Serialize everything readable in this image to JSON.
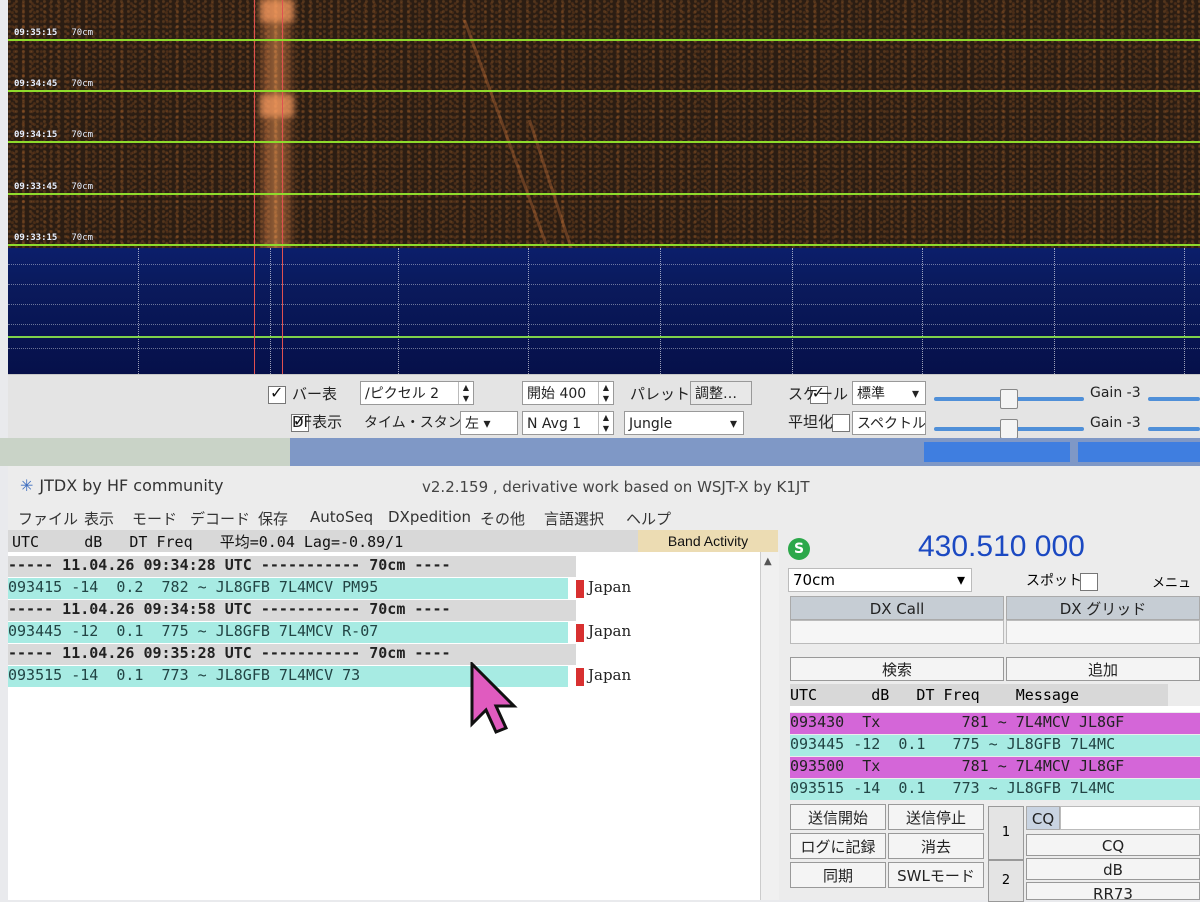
{
  "waterfall": {
    "rows": [
      {
        "time": "09:35:15",
        "band": "70cm"
      },
      {
        "time": "09:34:45",
        "band": "70cm"
      },
      {
        "time": "09:34:15",
        "band": "70cm"
      },
      {
        "time": "09:33:45",
        "band": "70cm"
      },
      {
        "time": "09:33:15",
        "band": "70cm"
      }
    ]
  },
  "controls": {
    "bar_label": "バー表",
    "df_label": "DF表示",
    "bins_label": "/ピクセル",
    "bins_value": "2",
    "timestamp_label": "タイム・スタンプ",
    "timestamp_value": "左",
    "start_label": "開始 400",
    "navg_label": "N Avg 1",
    "palette_label": "パレット",
    "adjust_button": "調整…",
    "palette_value": "Jungle",
    "scale_label": "スケール",
    "scale_value": "標準",
    "flatten_label": "平坦化",
    "spectrum_value": "スペクトル",
    "gain1_label": "Gain -3",
    "gain2_label": "Gain -3"
  },
  "window": {
    "title": "JTDX   by HF community",
    "version": "v2.2.159 , derivative work based on WSJT-X by K1JT"
  },
  "menu": [
    "ファイル",
    "表示",
    "モード",
    "デコード",
    "保存",
    "AutoSeq",
    "DXpedition",
    "その他",
    "言語選択",
    "ヘルプ"
  ],
  "band_activity": {
    "header": "UTC     dB   DT Freq   平均=0.04 Lag=-0.89/1",
    "label": "Band Activity",
    "rows": [
      {
        "kind": "sep",
        "text": "----- 11.04.26 09:34:28 UTC ----------- 70cm ----"
      },
      {
        "kind": "dec",
        "text": "093415 -14  0.2  782 ~ JL8GFB 7L4MCV PM95",
        "country": "Japan"
      },
      {
        "kind": "sep",
        "text": "----- 11.04.26 09:34:58 UTC ----------- 70cm ----"
      },
      {
        "kind": "dec",
        "text": "093445 -12  0.1  775 ~ JL8GFB 7L4MCV R-07",
        "country": "Japan"
      },
      {
        "kind": "sep",
        "text": "----- 11.04.26 09:35:28 UTC ----------- 70cm ----"
      },
      {
        "kind": "dec",
        "text": "093515 -14  0.1  773 ~ JL8GFB 7L4MCV 73",
        "country": "Japan"
      }
    ]
  },
  "right": {
    "status_icon": "S",
    "frequency": "430.510 000",
    "band_select": "70cm",
    "spot_label": "スポット",
    "menu_label": "メニュー",
    "dxcall_button": "DX Call",
    "dxgrid_button": "DX グリッド",
    "search_button": "検索",
    "add_button": "追加",
    "rx_header": "UTC      dB   DT Freq    Message",
    "rx_rows": [
      {
        "kind": "tx",
        "text": "093430  Tx         781 ~ 7L4MCV JL8GF"
      },
      {
        "kind": "rx",
        "text": "093445 -12  0.1   775 ~ JL8GFB 7L4MC"
      },
      {
        "kind": "tx",
        "text": "093500  Tx         781 ~ 7L4MCV JL8GF"
      },
      {
        "kind": "rx",
        "text": "093515 -14  0.1   773 ~ JL8GFB 7L4MC"
      }
    ],
    "tx_start": "送信開始",
    "tx_stop": "送信停止",
    "log_button": "ログに記録",
    "erase_button": "消去",
    "sync_button": "同期",
    "swl_button": "SWLモード",
    "tab1": "1",
    "tab2": "2",
    "cq_small": "CQ",
    "cq_button": "CQ",
    "db_button": "dB",
    "rr73_button": "RR73"
  }
}
